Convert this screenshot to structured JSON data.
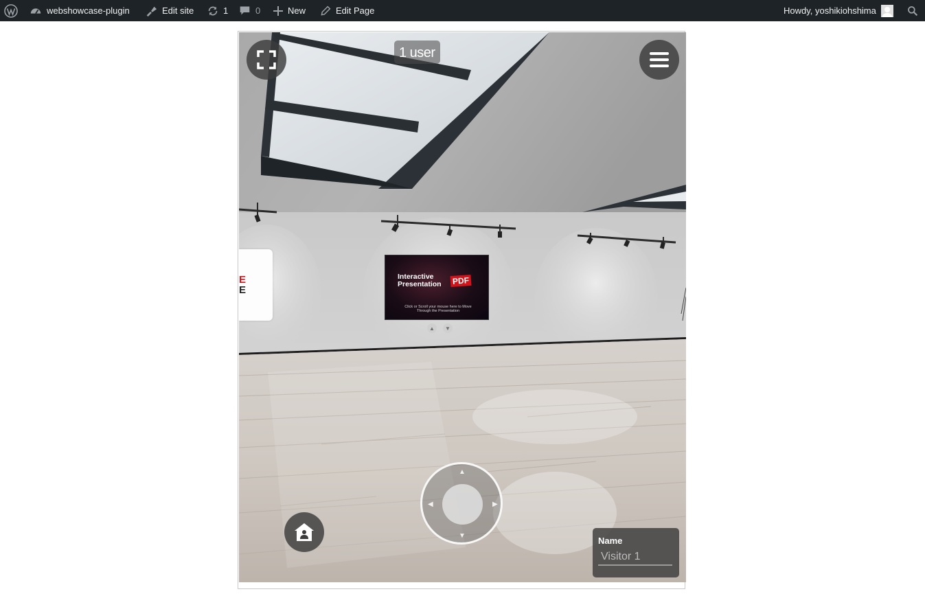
{
  "admin_bar": {
    "site_name": "webshowcase-plugin",
    "edit_site": "Edit site",
    "updates_count": "1",
    "comments_count": "0",
    "new_label": "New",
    "edit_page": "Edit Page",
    "howdy": "Howdy, yoshikiohshima"
  },
  "viewer": {
    "user_count": "1 user",
    "name_label": "Name",
    "name_placeholder": "Visitor 1",
    "poster": {
      "title": "Interactive Presentation",
      "badge": "PDF",
      "subtitle": "Click or Scroll your mouse here to Move Through the Presentation"
    },
    "left_sign": {
      "line1": "E",
      "line2": "E"
    }
  },
  "colors": {
    "admin_bar_bg": "#1d2327",
    "pdf_badge": "#d2141a"
  },
  "icons": {
    "wordpress": "wordpress-logo-icon",
    "dashboard": "dashboard-icon",
    "edit_site": "brush-icon",
    "updates": "refresh-icon",
    "comments": "comment-icon",
    "new": "plus-icon",
    "edit": "pencil-icon",
    "avatar": "avatar-icon",
    "search": "search-icon",
    "fullscreen": "fullscreen-icon",
    "menu": "hamburger-menu-icon",
    "home": "home-icon"
  }
}
